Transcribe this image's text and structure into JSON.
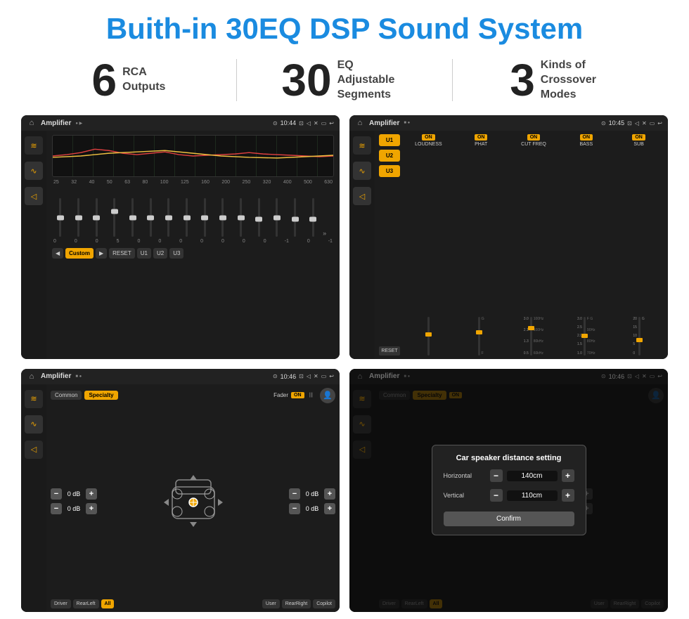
{
  "header": {
    "title": "Buith-in 30EQ DSP Sound System"
  },
  "stats": [
    {
      "number": "6",
      "label": "RCA\nOutputs"
    },
    {
      "number": "30",
      "label": "EQ Adjustable\nSegments"
    },
    {
      "number": "3",
      "label": "Kinds of\nCrossover Modes"
    }
  ],
  "screens": {
    "eq": {
      "title": "Amplifier",
      "time": "10:44",
      "freq_labels": [
        "25",
        "32",
        "40",
        "50",
        "63",
        "80",
        "100",
        "125",
        "160",
        "200",
        "250",
        "320",
        "400",
        "500",
        "630"
      ],
      "values": [
        "0",
        "0",
        "0",
        "5",
        "0",
        "0",
        "0",
        "0",
        "0",
        "0",
        "0",
        "-1",
        "0",
        "-1"
      ],
      "buttons": [
        "Custom",
        "RESET",
        "U1",
        "U2",
        "U3"
      ]
    },
    "crossover": {
      "title": "Amplifier",
      "time": "10:45",
      "channels": [
        "LOUDNESS",
        "PHAT",
        "CUT FREQ",
        "BASS",
        "SUB"
      ],
      "u_buttons": [
        "U1",
        "U2",
        "U3"
      ]
    },
    "fader": {
      "title": "Amplifier",
      "time": "10:46",
      "tabs": [
        "Common",
        "Specialty"
      ],
      "fader_label": "Fader",
      "vol_values": [
        "0 dB",
        "0 dB",
        "0 dB",
        "0 dB"
      ],
      "bottom_buttons": [
        "Driver",
        "RearLeft",
        "All",
        "User",
        "RearRight",
        "Copilot"
      ]
    },
    "speaker": {
      "title": "Amplifier",
      "time": "10:46",
      "dialog": {
        "title": "Car speaker distance setting",
        "horizontal_label": "Horizontal",
        "horizontal_value": "140cm",
        "vertical_label": "Vertical",
        "vertical_value": "110cm",
        "confirm_label": "Confirm"
      },
      "tabs": [
        "Common",
        "Specialty"
      ],
      "bottom_buttons": [
        "Driver",
        "RearLeft",
        "All",
        "User",
        "RearRight",
        "Copilot"
      ]
    }
  },
  "icons": {
    "home": "⌂",
    "nav_dot": "●",
    "music": "♫",
    "speaker": "🔊",
    "eq_icon": "≋",
    "fader_icon": "⇔",
    "back": "↩",
    "loc": "⊙",
    "camera": "⊡",
    "volume": "▣",
    "close": "✕",
    "minus": "−",
    "plus": "+"
  },
  "colors": {
    "orange": "#f0a500",
    "blue": "#1a8be0",
    "dark_bg": "#1a1a1a",
    "panel_bg": "#1c1c1c"
  }
}
